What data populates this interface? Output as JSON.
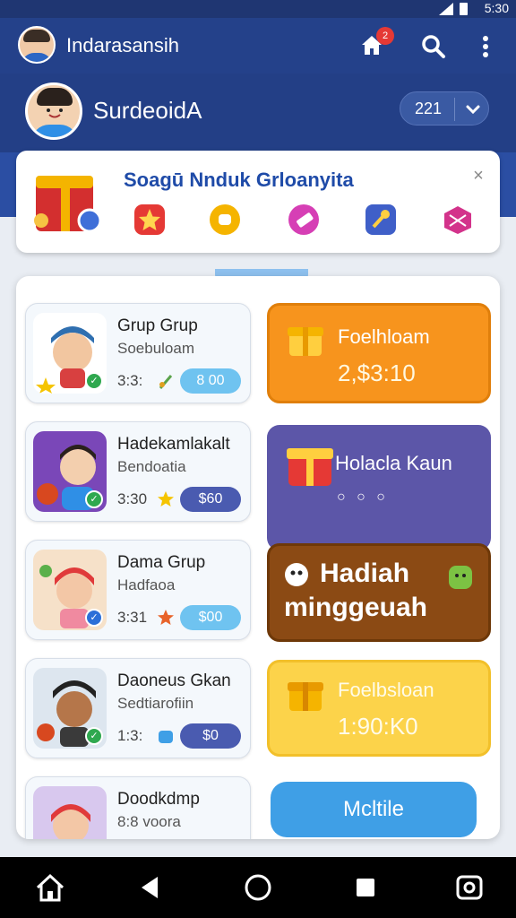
{
  "status": {
    "time": "5:30"
  },
  "topbar": {
    "username": "Indarasansih",
    "notif_count": "2"
  },
  "profile": {
    "name": "SurdeoidA",
    "counter": "221"
  },
  "banner": {
    "title": "Soagū Nnduk Grloanyita",
    "icon_colors": [
      "#e53935",
      "#f5b400",
      "#d63fb5",
      "#3f5fc8",
      "#d3338b"
    ]
  },
  "cards": [
    {
      "title": "Grup Grup",
      "subtitle": "Soebuloam",
      "time": "3:3:",
      "amount": "8 00",
      "pill_color": "#6fc3f0"
    },
    {
      "title": "Hadekamlakalt",
      "subtitle": "Bendoatia",
      "time": "3:30",
      "amount": "$60",
      "pill_color": "#4a5bb0"
    },
    {
      "title": "Dama Grup",
      "subtitle": "Hadfaoa",
      "time": "3:31",
      "amount": "$00",
      "pill_color": "#6fc3f0"
    },
    {
      "title": "Daoneus Gkan",
      "subtitle": "Sedtiarofiin",
      "time": "1:3:",
      "amount": "$0",
      "pill_color": "#4a5bb0"
    },
    {
      "title": "Doodkdmp",
      "subtitle": "8:8 voora"
    }
  ],
  "tiles": {
    "orange": {
      "label": "Foelhloam",
      "value": "2,$3:10"
    },
    "purple": {
      "label": "Holacla Kaun",
      "dots": "○ ○ ○"
    },
    "brown": {
      "line1": "Hadiah",
      "line2": "minggeuah"
    },
    "yellow": {
      "label": "Foelbsloan",
      "value": "1:90:K0"
    }
  },
  "bottom_button": "Mcltile",
  "icons": {
    "home": "home-icon",
    "search": "search-icon",
    "more": "more-vert-icon",
    "chevron": "chevron-down-icon",
    "close": "close-icon",
    "nav": [
      "house-icon",
      "back-icon",
      "home-circle-icon",
      "recents-icon",
      "screenshot-icon"
    ]
  }
}
